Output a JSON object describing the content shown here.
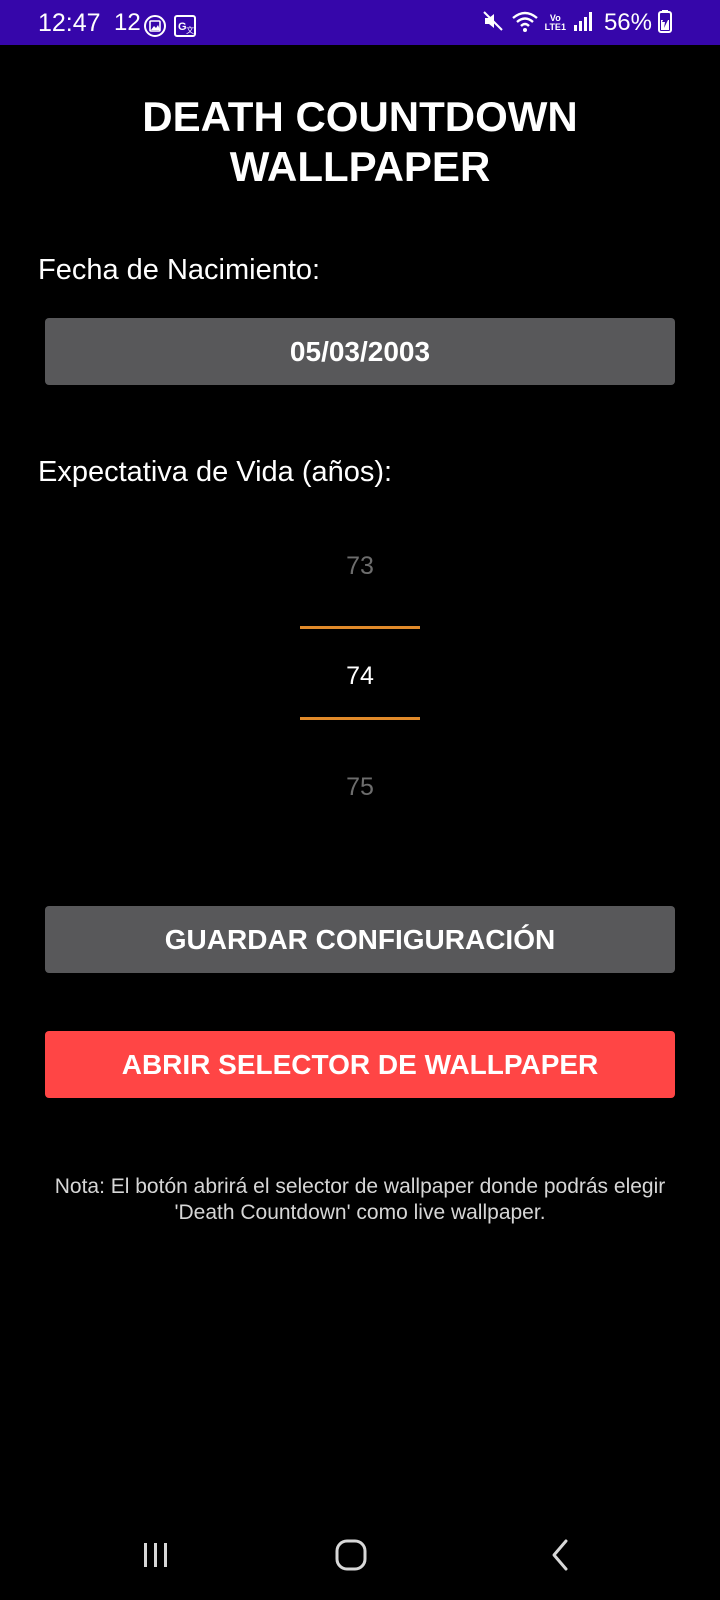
{
  "status_bar": {
    "time": "12:47",
    "notification_count": "12",
    "battery_percent": "56%",
    "volte_label": "Vo\nLTE1",
    "icons": [
      "gallery-icon",
      "translate-icon",
      "mute-icon",
      "wifi-icon",
      "volte-icon",
      "signal-icon",
      "battery-charging-icon"
    ],
    "background_color": "#3606aa"
  },
  "app": {
    "title": "DEATH COUNTDOWN\nWALLPAPER",
    "birth_date_label": "Fecha de Nacimiento:",
    "birth_date_value": "05/03/2003",
    "life_expectancy_label": "Expectativa de Vida (años):",
    "picker": {
      "previous": "73",
      "selected": "74",
      "next": "75",
      "divider_color": "#e18a2a"
    },
    "save_button_label": "GUARDAR CONFIGURACIÓN",
    "open_selector_button_label": "ABRIR SELECTOR DE WALLPAPER",
    "note": "Nota: El botón abrirá el selector de wallpaper donde podrás elegir 'Death Countdown' como live wallpaper."
  },
  "colors": {
    "background": "#000000",
    "button_gray": "#58585a",
    "button_red": "#ff4545",
    "text": "#ffffff",
    "note_text": "#d6d6d6"
  },
  "nav_bar": {
    "icons": [
      "recent-apps-icon",
      "home-icon",
      "back-icon"
    ]
  }
}
